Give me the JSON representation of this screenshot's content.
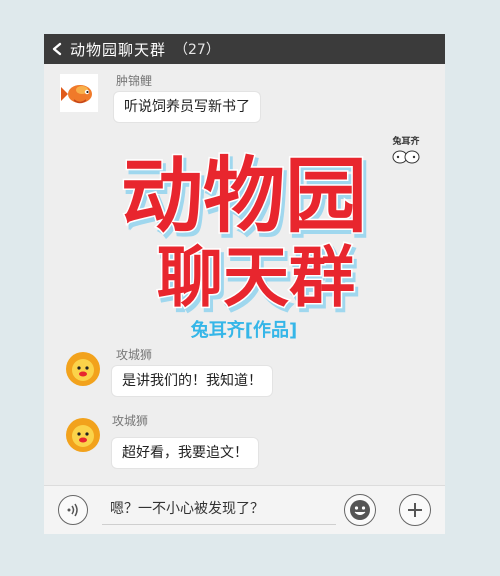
{
  "header": {
    "back_icon": "chevron-left-icon",
    "title": "动物园聊天群",
    "member_count": "（27）"
  },
  "messages": [
    {
      "sender": "肿锦鲤",
      "text": "听说饲养员写新书了",
      "avatar": "goldfish-avatar"
    },
    {
      "sender": "攻城狮",
      "text": "是讲我们的！我知道！",
      "avatar": "lion-avatar"
    },
    {
      "sender": "攻城狮",
      "text": "超好看，我要追文！",
      "avatar": "lion-avatar"
    }
  ],
  "poster": {
    "line1": "动物园",
    "line2": "聊天群",
    "author": "兔耳齐[作品]",
    "sticker_label": "兔耳齐"
  },
  "input_bar": {
    "voice_icon": "voice-icon",
    "text": "嗯？一不小心被发现了？",
    "emoji_icon": "smiley-icon",
    "add_icon": "plus-icon"
  },
  "colors": {
    "title_bar": "#3b3b3b",
    "poster_red": "#e8262e",
    "author_blue": "#35b6e8",
    "background": "#eeeeee"
  }
}
